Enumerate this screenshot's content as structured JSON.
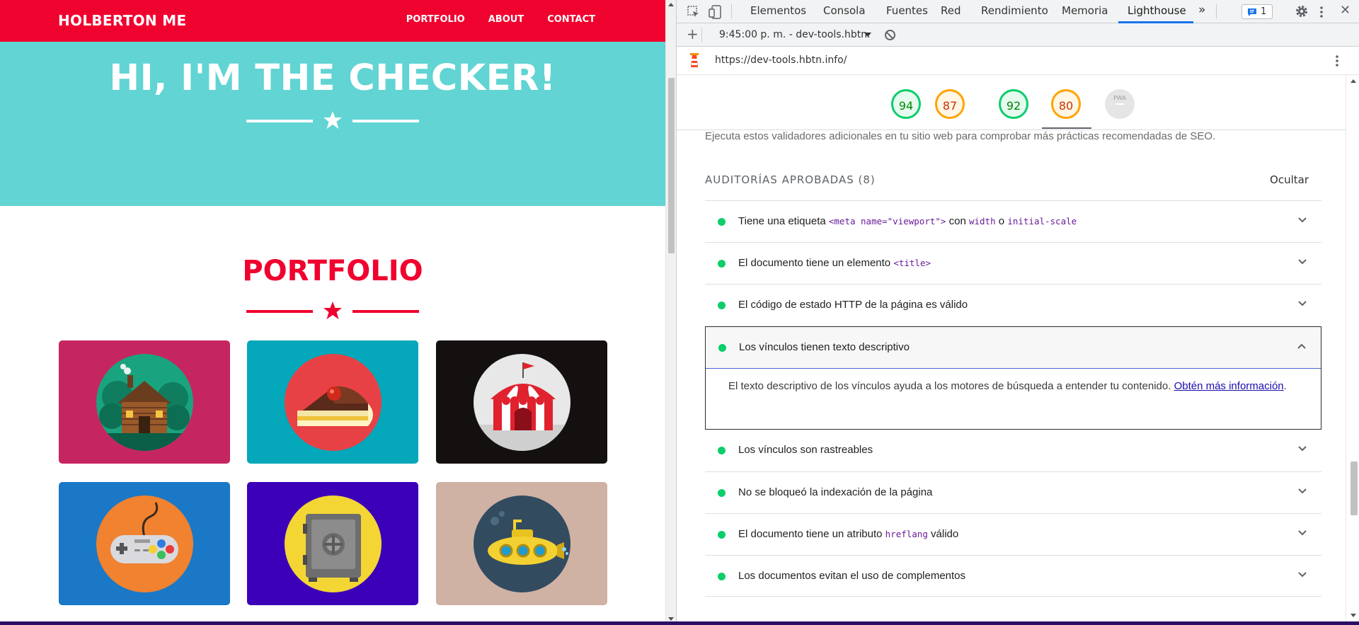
{
  "site": {
    "brand": "HOLBERTON ME",
    "nav": [
      "PORTFOLIO",
      "ABOUT",
      "CONTACT"
    ],
    "hero_title": "HI, I'M THE CHECKER!",
    "portfolio_title": "PORTFOLIO",
    "tiles": [
      {
        "name": "cabin",
        "bg": "#c6265f",
        "circle": "#1aa37f"
      },
      {
        "name": "cake",
        "bg": "#05a7ba",
        "circle": "#e84145"
      },
      {
        "name": "circus",
        "bg": "#141010",
        "circle": "#e8e8e8"
      },
      {
        "name": "controller",
        "bg": "#1b78c6",
        "circle": "#f08230"
      },
      {
        "name": "safe",
        "bg": "#3b00b8",
        "circle": "#f3d634"
      },
      {
        "name": "submarine",
        "bg": "#cfb2a4",
        "circle": "#334b5f"
      }
    ],
    "colors": {
      "primary": "#f0022f",
      "hero": "#61d4d3"
    }
  },
  "devtools": {
    "tabs": [
      "Elementos",
      "Consola",
      "Fuentes",
      "Red",
      "Rendimiento",
      "Memoria",
      "Lighthouse"
    ],
    "active_tab": "Lighthouse",
    "more_tabs": "»",
    "issues_count": "1",
    "report_selector": "9:45:00 p. m. - dev-tools.hbtn.",
    "url": "https://dev-tools.hbtn.info/",
    "scores": [
      {
        "value": "94",
        "status": "pass",
        "color": "#0cce6b"
      },
      {
        "value": "87",
        "status": "average",
        "color": "#ffa400"
      },
      {
        "value": "92",
        "status": "pass",
        "color": "#0cce6b"
      },
      {
        "value": "80",
        "status": "average",
        "color": "#ffa400"
      },
      {
        "value": "PWA",
        "status": "na",
        "color": "#dadce0"
      }
    ],
    "seo_note": "Ejecuta estos validadores adicionales en tu sitio web para comprobar más prácticas recomendadas de SEO.",
    "passed_header": "AUDITORÍAS APROBADAS",
    "passed_count": "(8)",
    "hide_label": "Ocultar",
    "audits": [
      {
        "pre": "Tiene una etiqueta ",
        "code1": "<meta name=\"viewport\">",
        "mid": " con ",
        "code2": "width",
        "mid2": " o ",
        "code3": "initial-scale"
      },
      {
        "pre": "El documento tiene un elemento ",
        "code1": "<title>"
      },
      {
        "pre": "El código de estado HTTP de la página es válido"
      },
      {
        "pre": "Los vínculos tienen texto descriptivo",
        "expanded": true,
        "desc": "El texto descriptivo de los vínculos ayuda a los motores de búsqueda a entender tu contenido. ",
        "link": "Obtén más información"
      },
      {
        "pre": "Los vínculos son rastreables"
      },
      {
        "pre": "No se bloqueó la indexación de la página"
      },
      {
        "pre": "El documento tiene un atributo ",
        "code1": "hreflang",
        "post": " válido"
      },
      {
        "pre": "Los documentos evitan el uso de complementos"
      }
    ]
  }
}
